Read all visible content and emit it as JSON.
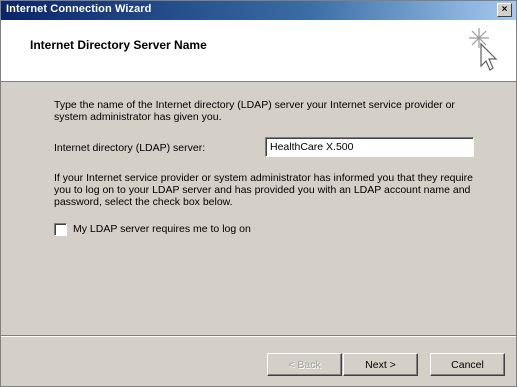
{
  "window": {
    "title": "Internet Connection Wizard",
    "close_label": "×"
  },
  "header": {
    "title": "Internet Directory Server Name",
    "icon": "wizard-sparkle-cursor-icon"
  },
  "content": {
    "instructions": "Type the name of the Internet directory (LDAP) server your Internet service provider or system administrator has given you.",
    "server_label": "Internet directory (LDAP) server:",
    "server_value": "HealthCare X.500",
    "logon_info": "If your Internet service provider or system administrator has informed you that they require you to log on to your LDAP server and has provided you with an LDAP account name and password, select the check box below.",
    "checkbox_label": "My LDAP server requires me to log on",
    "checkbox_checked": false
  },
  "buttons": {
    "back_label": "< Back",
    "next_label": "Next >",
    "cancel_label": "Cancel"
  },
  "colors": {
    "title_gradient_start": "#0a246a",
    "title_gradient_end": "#a6caf0",
    "dialog_face": "#d4d0c8"
  }
}
